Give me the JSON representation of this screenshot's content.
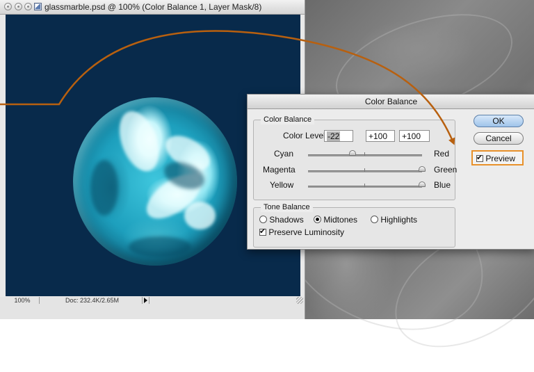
{
  "window": {
    "title": "glassmarble.psd @ 100% (Color Balance 1, Layer Mask/8)"
  },
  "status": {
    "zoom": "100%",
    "doc_size": "Doc: 232.4K/2.65M"
  },
  "dialog": {
    "title": "Color Balance",
    "ok_label": "OK",
    "cancel_label": "Cancel",
    "preview_label": "Preview",
    "preview_checked": true,
    "color_balance": {
      "group_title": "Color Balance",
      "levels_label": "Color Levels:",
      "levels": [
        "-22",
        "+100",
        "+100"
      ],
      "sliders": [
        {
          "left": "Cyan",
          "right": "Red",
          "value": -22
        },
        {
          "left": "Magenta",
          "right": "Green",
          "value": 100
        },
        {
          "left": "Yellow",
          "right": "Blue",
          "value": 100
        }
      ]
    },
    "tone_balance": {
      "group_title": "Tone Balance",
      "shadows_label": "Shadows",
      "midtones_label": "Midtones",
      "highlights_label": "Highlights",
      "selected": "Midtones",
      "preserve_label": "Preserve Luminosity",
      "preserve_checked": true
    }
  },
  "colors": {
    "canvas": "#082a4b",
    "annotation_arrow": "#b8600f",
    "preview_highlight": "#e8912a"
  }
}
